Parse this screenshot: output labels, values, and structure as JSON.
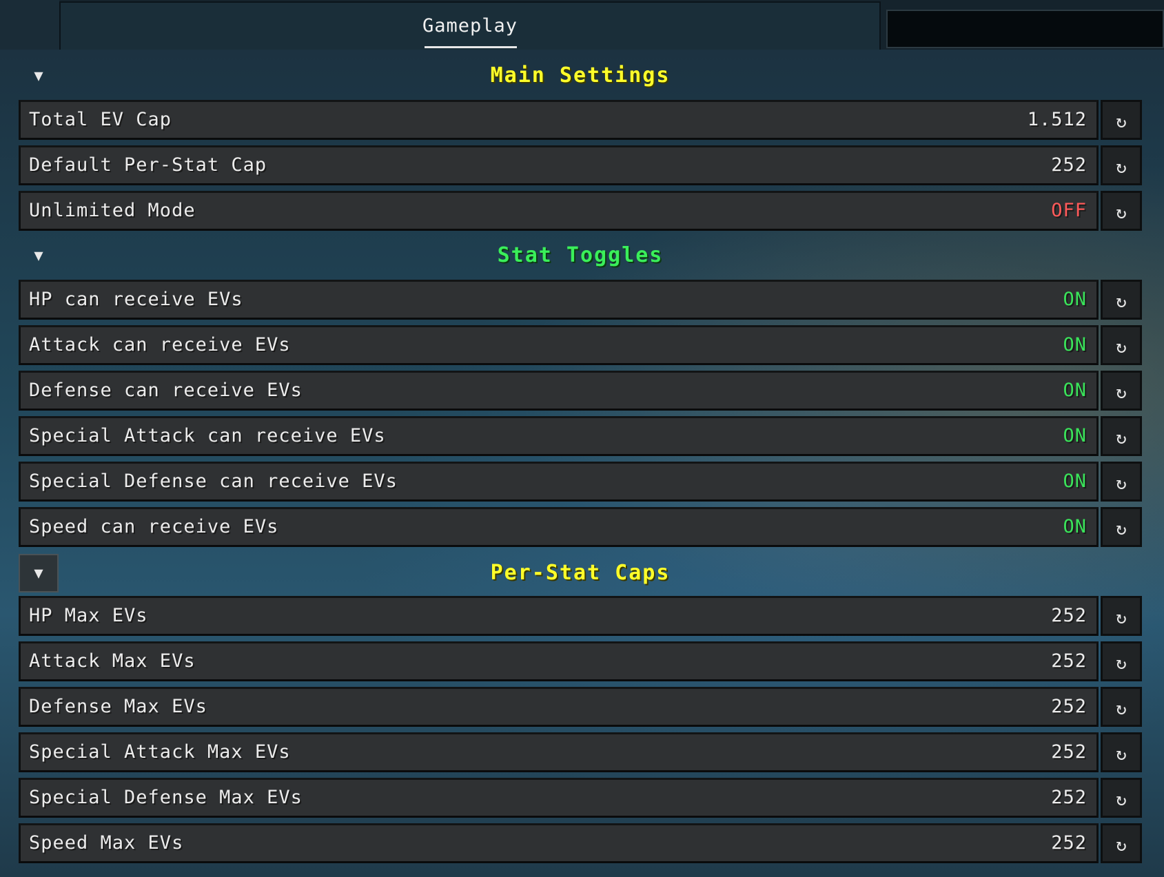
{
  "tabs": {
    "active_label": "Gameplay"
  },
  "colors": {
    "on": "#3ae35a",
    "off": "#ff5a5a",
    "value": "#ececec",
    "main_title": "#ffff2a",
    "toggle_title": "#3aef5a",
    "caps_title": "#ffff2a"
  },
  "icons": {
    "collapse": "chevron-down-icon",
    "reset": "reset-icon"
  },
  "sections": [
    {
      "title": "Main Settings",
      "rows": [
        {
          "label": "Total EV Cap",
          "value": "1.512"
        },
        {
          "label": "Default Per-Stat Cap",
          "value": "252"
        },
        {
          "label": "Unlimited Mode",
          "value": "OFF"
        }
      ]
    },
    {
      "title": "Stat Toggles",
      "rows": [
        {
          "label": "HP can receive EVs",
          "value": "ON"
        },
        {
          "label": "Attack can receive EVs",
          "value": "ON"
        },
        {
          "label": "Defense can receive EVs",
          "value": "ON"
        },
        {
          "label": "Special Attack can receive EVs",
          "value": "ON"
        },
        {
          "label": "Special Defense can receive EVs",
          "value": "ON"
        },
        {
          "label": "Speed can receive EVs",
          "value": "ON"
        }
      ]
    },
    {
      "title": "Per-Stat Caps",
      "rows": [
        {
          "label": "HP Max EVs",
          "value": "252"
        },
        {
          "label": "Attack Max EVs",
          "value": "252"
        },
        {
          "label": "Defense Max EVs",
          "value": "252"
        },
        {
          "label": "Special Attack Max EVs",
          "value": "252"
        },
        {
          "label": "Special Defense Max EVs",
          "value": "252"
        },
        {
          "label": "Speed Max EVs",
          "value": "252"
        }
      ]
    }
  ]
}
